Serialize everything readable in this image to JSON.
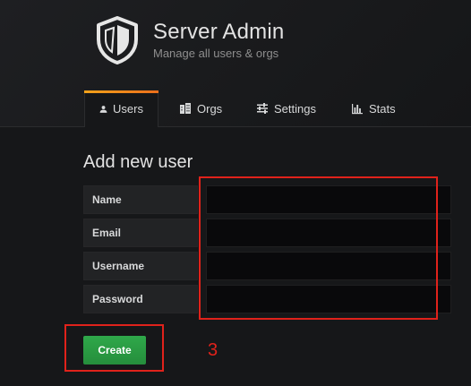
{
  "header": {
    "title": "Server Admin",
    "subtitle": "Manage all users & orgs",
    "icon": "shield-icon"
  },
  "tabs": [
    {
      "label": "Users",
      "icon": "user-icon",
      "active": true
    },
    {
      "label": "Orgs",
      "icon": "building-icon",
      "active": false
    },
    {
      "label": "Settings",
      "icon": "sliders-icon",
      "active": false
    },
    {
      "label": "Stats",
      "icon": "bar-chart-icon",
      "active": false
    }
  ],
  "form": {
    "title": "Add new user",
    "fields": [
      {
        "label": "Name",
        "value": ""
      },
      {
        "label": "Email",
        "value": ""
      },
      {
        "label": "Username",
        "value": ""
      },
      {
        "label": "Password",
        "value": ""
      }
    ],
    "submit_label": "Create"
  },
  "annotation": {
    "number": "3",
    "color": "#e0221b"
  },
  "colors": {
    "accent": "#f2a21a",
    "button": "#2fa84a",
    "background": "#161719"
  }
}
